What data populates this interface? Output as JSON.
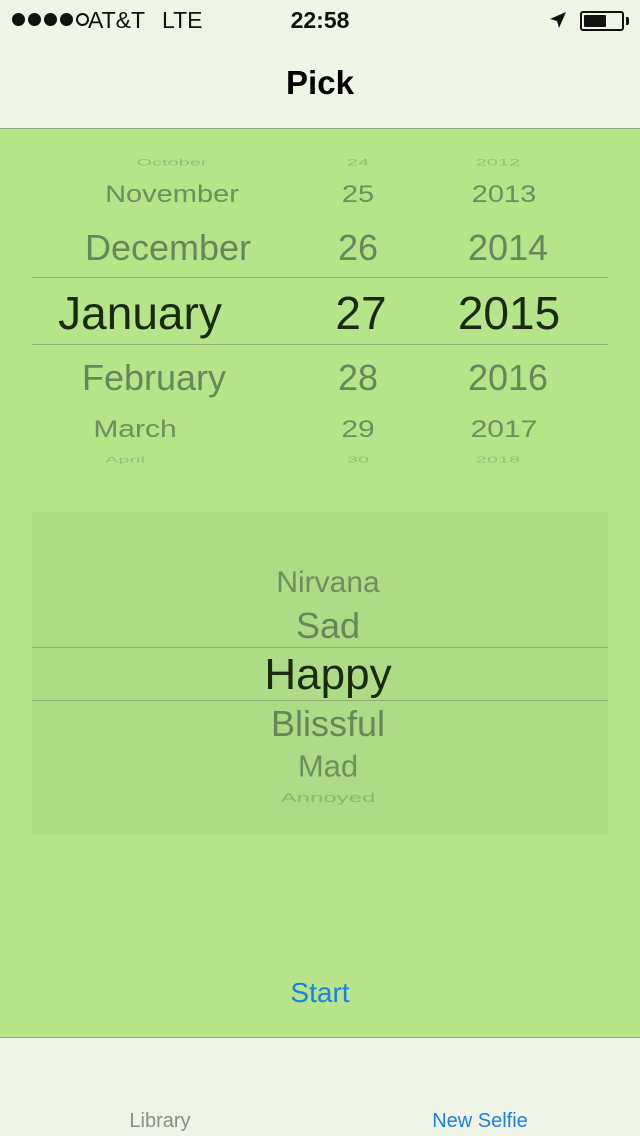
{
  "status_bar": {
    "carrier": "AT&T",
    "network": "LTE",
    "time": "22:58",
    "signal_bars_filled": 4,
    "signal_bars_total": 5,
    "battery_level": 0.6,
    "icons": [
      "location-arrow-icon",
      "battery-icon"
    ]
  },
  "nav": {
    "title": "Pick"
  },
  "date_picker": {
    "months": [
      "October",
      "November",
      "December",
      "January",
      "February",
      "March",
      "April"
    ],
    "days": [
      "24",
      "25",
      "26",
      "27",
      "28",
      "29",
      "30"
    ],
    "years": [
      "2012",
      "2013",
      "2014",
      "2015",
      "2016",
      "2017",
      "2018"
    ],
    "selected": {
      "month": "January",
      "day": "27",
      "year": "2015"
    }
  },
  "mood_picker": {
    "options": [
      "Nirvana",
      "Sad",
      "Happy",
      "Blissful",
      "Mad",
      "Annoyed"
    ],
    "selected": "Happy"
  },
  "start_label": "Start",
  "tabs": [
    {
      "label": "Library",
      "selected": false
    },
    {
      "label": "New Selfie",
      "selected": true
    }
  ],
  "colors": {
    "background": "#b5e588",
    "bar": "#eef5e6",
    "accent": "#1e7fe3"
  }
}
